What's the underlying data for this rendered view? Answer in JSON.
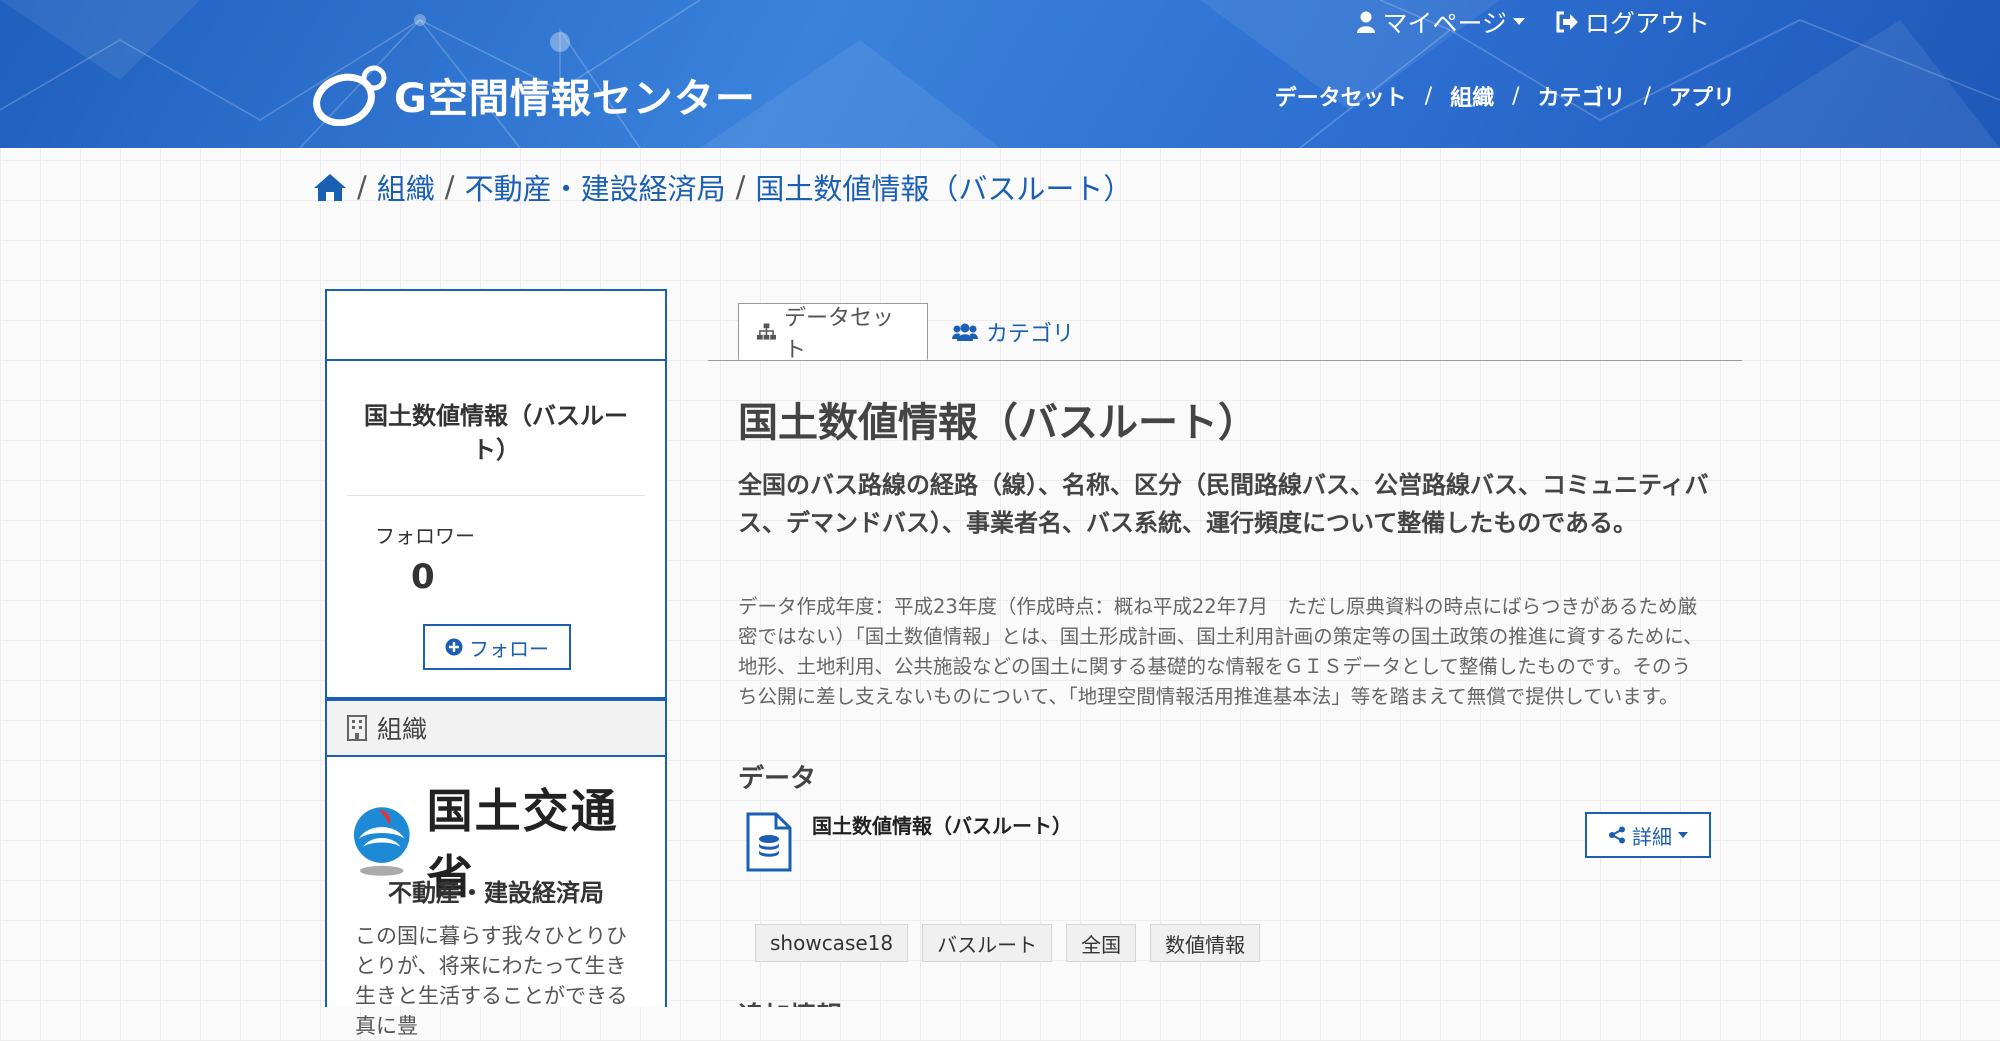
{
  "header": {
    "logo_text": "G空間情報センター",
    "mypage_label": "マイページ",
    "logout_label": "ログアウト",
    "nav": [
      {
        "label": "データセット"
      },
      {
        "label": "組織"
      },
      {
        "label": "カテゴリ"
      },
      {
        "label": "アプリ"
      }
    ]
  },
  "breadcrumb": {
    "items": [
      "組織",
      "不動産・建設経済局",
      "国土数値情報（バスルート）"
    ]
  },
  "sidebar": {
    "title": "国土数値情報（バスルート）",
    "followers_label": "フォロワー",
    "followers_count": "0",
    "follow_button": "フォロー",
    "org_section_label": "組織",
    "org_logo_text": "国土交通省",
    "org_name": "不動産・建設経済局",
    "org_desc": "この国に暮らす我々ひとりひとりが、将来にわたって生き生きと生活することができる真に豊"
  },
  "tabs": {
    "dataset": "データセット",
    "category": "カテゴリ"
  },
  "dataset": {
    "title": "国土数値情報（バスルート）",
    "summary": "全国のバス路線の経路（線）、名称、区分（民間路線バス、公営路線バス、コミュニティバス、デマンドバス）、事業者名、バス系統、運行頻度について整備したものである。",
    "description": "データ作成年度：平成23年度（作成時点：概ね平成22年7月　ただし原典資料の時点にばらつきがあるため厳密ではない）「国土数値情報」とは、国土形成計画、国土利用計画の策定等の国土政策の推進に資するために、地形、土地利用、公共施設などの国土に関する基礎的な情報をＧＩＳデータとして整備したものです。そのうち公開に差し支えないものについて、「地理空間情報活用推進基本法」等を踏まえて無償で提供しています。",
    "data_heading": "データ",
    "resource_title": "国土数値情報（バスルート）",
    "detail_button": "詳細",
    "tags": [
      "showcase18",
      "バスルート",
      "全国",
      "数値情報"
    ],
    "extra_heading": "追加情報"
  },
  "colors": {
    "accent": "#1a5fb4",
    "header_bg": "#2c6ed0"
  }
}
